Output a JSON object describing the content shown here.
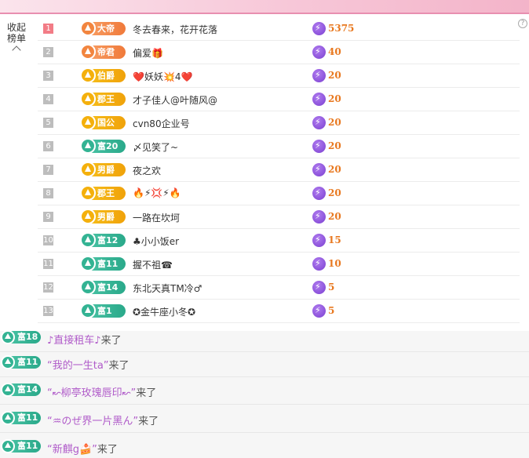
{
  "panel": {
    "collapse_label": "收起榜单",
    "help_glyph": "?"
  },
  "rank_list": [
    {
      "rank": "1",
      "badge": "大帝",
      "badge_style": "orange",
      "name": "冬去春来，花开花落",
      "value": "5375"
    },
    {
      "rank": "2",
      "badge": "帝君",
      "badge_style": "orange",
      "name": "偏爱🎁",
      "value": "40"
    },
    {
      "rank": "3",
      "badge": "伯爵",
      "badge_style": "gold",
      "name": "❤️妖妖💥4❤️",
      "value": "20"
    },
    {
      "rank": "4",
      "badge": "郡王",
      "badge_style": "gold",
      "name": "才子佳人@叶随风@",
      "value": "20"
    },
    {
      "rank": "5",
      "badge": "国公",
      "badge_style": "gold",
      "name": "cvn80企业号",
      "value": "20"
    },
    {
      "rank": "6",
      "badge": "富20",
      "badge_style": "teal",
      "name": "〆见笑了~",
      "value": "20"
    },
    {
      "rank": "7",
      "badge": "男爵",
      "badge_style": "gold",
      "name": "夜之欢",
      "value": "20"
    },
    {
      "rank": "8",
      "badge": "郡王",
      "badge_style": "gold",
      "name": "🔥⚡💢⚡🔥",
      "value": "20"
    },
    {
      "rank": "9",
      "badge": "男爵",
      "badge_style": "gold",
      "name": "一路在坎坷",
      "value": "20"
    },
    {
      "rank": "10",
      "badge": "富12",
      "badge_style": "teal",
      "name": "♣小小饭er",
      "value": "15"
    },
    {
      "rank": "11",
      "badge": "富11",
      "badge_style": "teal",
      "name": "握不祖☎",
      "value": "10"
    },
    {
      "rank": "12",
      "badge": "富14",
      "badge_style": "teal",
      "name": "东北天真TM冷♂",
      "value": "5"
    },
    {
      "rank": "13",
      "badge": "富1",
      "badge_style": "teal",
      "name": "✪金牛座小冬✪",
      "value": "5"
    }
  ],
  "chat": [
    {
      "badge": "富18",
      "user": "♪直接租车♪",
      "tail": "来了"
    },
    {
      "badge": "富11",
      "user": "“我的一生ta”",
      "tail": "来了"
    },
    {
      "badge": "富14",
      "user": "“↜柳亭玫瑰唇印↜”",
      "tail": "来了"
    },
    {
      "badge": "富11",
      "user": "“♒のぜ界一片黑ん”",
      "tail": "来了"
    },
    {
      "badge": "富11",
      "user": "“新麒g🍰”",
      "tail": "来了"
    }
  ]
}
